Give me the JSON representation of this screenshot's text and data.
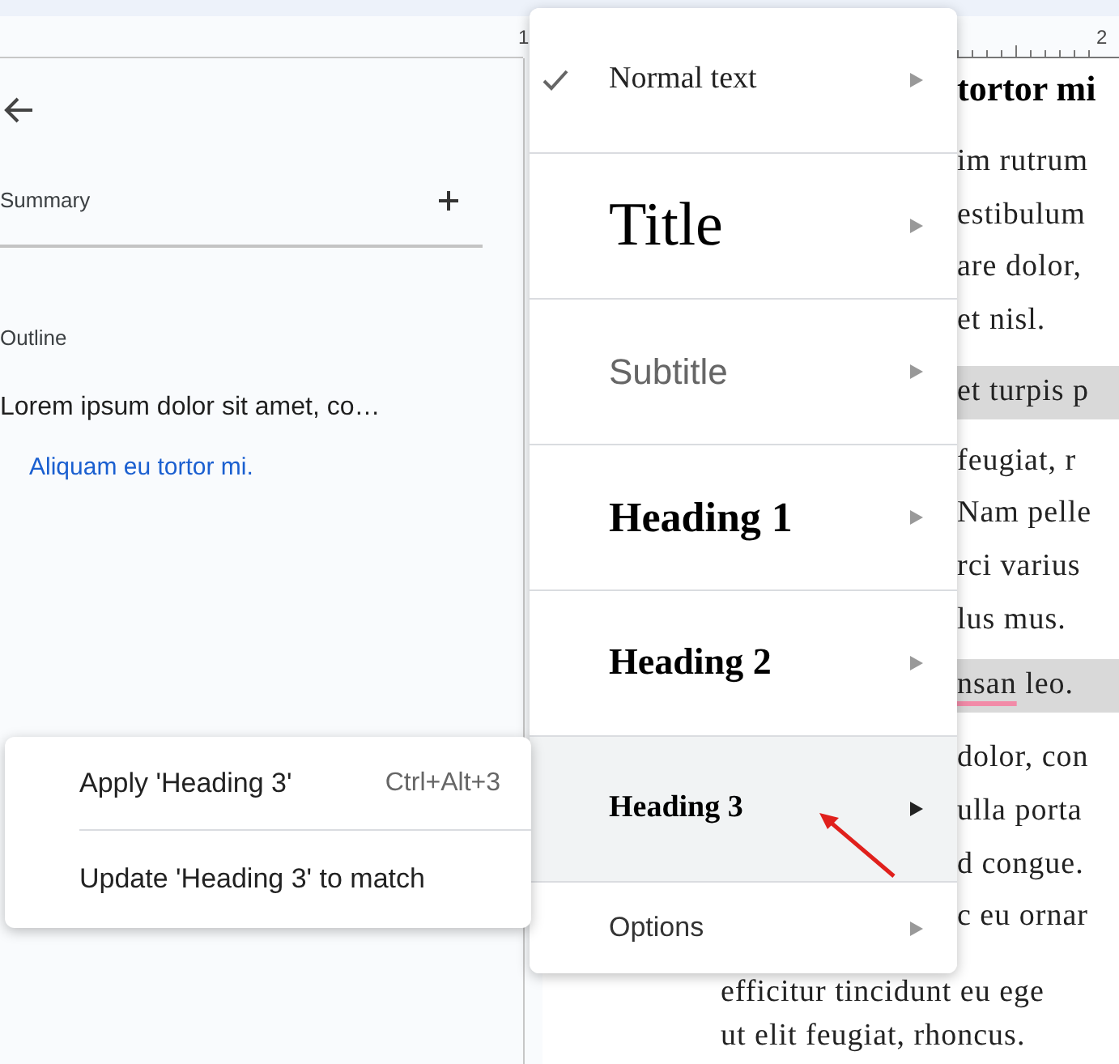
{
  "ruler": {
    "marks": [
      "1",
      "2"
    ]
  },
  "outline_panel": {
    "summary_label": "Summary",
    "outline_label": "Outline",
    "items": [
      {
        "text": "Lorem ipsum dolor sit amet, co…",
        "selected": false,
        "children": [
          {
            "text": "Aliquam eu tortor mi.",
            "selected": true
          }
        ]
      }
    ]
  },
  "document": {
    "heading": "tortor mi",
    "lines": [
      {
        "segments": [
          {
            "text": "im rutrum",
            "misspelled": false
          }
        ],
        "highlighted": false
      },
      {
        "segments": [
          {
            "text": "estibulum",
            "misspelled": false
          }
        ],
        "highlighted": false
      },
      {
        "segments": [
          {
            "text": "are dolor,",
            "misspelled": false
          }
        ],
        "highlighted": false
      },
      {
        "segments": [
          {
            "text": "et nisl.",
            "misspelled": false
          }
        ],
        "highlighted": false
      },
      {
        "segments": [
          {
            "text": "et turpis p",
            "misspelled": false
          }
        ],
        "highlighted": true
      },
      {
        "segments": [
          {
            "text": "feugiat, r",
            "misspelled": false
          }
        ],
        "highlighted": false
      },
      {
        "segments": [
          {
            "text": "Nam pelle",
            "misspelled": false
          }
        ],
        "highlighted": false
      },
      {
        "segments": [
          {
            "text": "rci varius",
            "misspelled": false
          }
        ],
        "highlighted": false
      },
      {
        "segments": [
          {
            "text": "lus mus.",
            "misspelled": false
          }
        ],
        "highlighted": false
      },
      {
        "segments": [
          {
            "text": "nsan",
            "misspelled": true
          },
          {
            "text": " leo.",
            "misspelled": false
          }
        ],
        "highlighted": true
      },
      {
        "segments": [
          {
            "text": "dolor, con",
            "misspelled": false
          }
        ],
        "highlighted": false
      },
      {
        "segments": [
          {
            "text": "ulla porta",
            "misspelled": false
          }
        ],
        "highlighted": false
      },
      {
        "segments": [
          {
            "text": "d congue.",
            "misspelled": false
          }
        ],
        "highlighted": false
      },
      {
        "segments": [
          {
            "text": "c eu ornar",
            "misspelled": false
          }
        ],
        "highlighted": false
      },
      {
        "segments": [
          {
            "text": "efficitur tincidunt eu ege",
            "misspelled": false
          }
        ],
        "highlighted": false
      },
      {
        "segments": [
          {
            "text": "ut elit feugiat, rhoncus.",
            "misspelled": false
          }
        ],
        "highlighted": false
      }
    ]
  },
  "styles_menu": {
    "items": [
      {
        "kind": "normal",
        "label": "Normal text",
        "checked": true,
        "selected": false
      },
      {
        "kind": "title",
        "label": "Title",
        "checked": false,
        "selected": false
      },
      {
        "kind": "subtitle",
        "label": "Subtitle",
        "checked": false,
        "selected": false
      },
      {
        "kind": "heading1",
        "label": "Heading 1",
        "checked": false,
        "selected": false
      },
      {
        "kind": "heading2",
        "label": "Heading 2",
        "checked": false,
        "selected": false
      },
      {
        "kind": "heading3",
        "label": "Heading 3",
        "checked": false,
        "selected": true
      },
      {
        "kind": "options",
        "label": "Options",
        "checked": false,
        "selected": false
      }
    ]
  },
  "submenu": {
    "items": [
      {
        "label": "Apply 'Heading 3'",
        "shortcut": "Ctrl+Alt+3"
      },
      {
        "label": "Update 'Heading 3' to match"
      }
    ]
  }
}
